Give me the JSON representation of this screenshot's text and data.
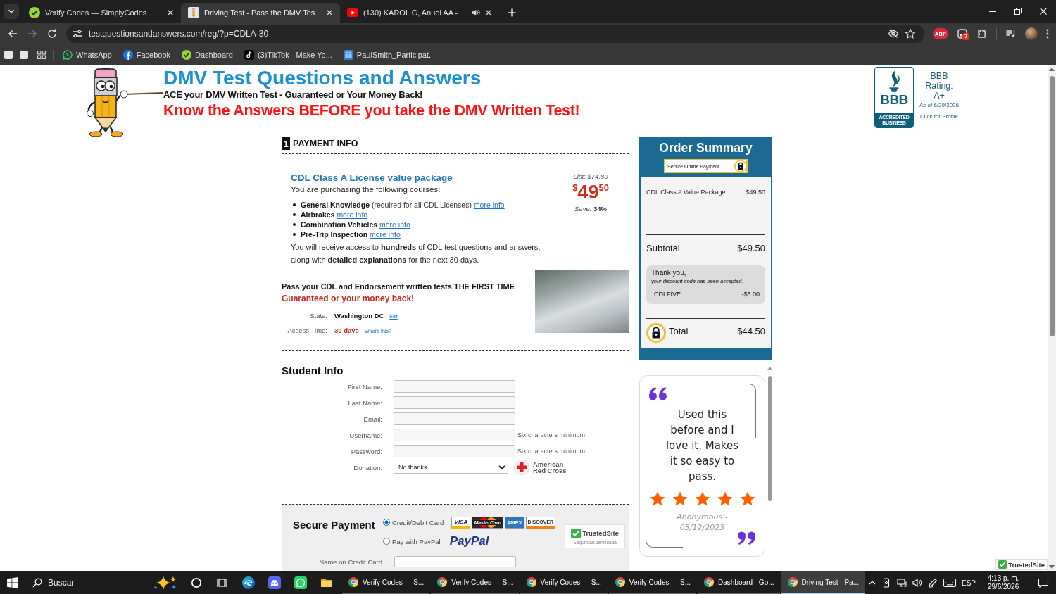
{
  "browser": {
    "tabs": [
      {
        "kind": "check",
        "title": "Verify Codes — SimplyCodes",
        "selected": false,
        "audible": false
      },
      {
        "kind": "pencil",
        "title": "Driving Test - Pass the DMV Tes",
        "selected": true,
        "audible": false
      },
      {
        "kind": "video",
        "title": "(130) KAROL G, Anuel AA -",
        "selected": false,
        "audible": true
      }
    ],
    "can_go_forward": false,
    "address": {
      "value": "testquestionsandanswers.com/reg/?p=CDLA-30"
    },
    "adblock_label": "ABP",
    "extension_badge": "7",
    "bookmarks": [
      {
        "kind": "chat",
        "label": "WhatsApp"
      },
      {
        "kind": "social",
        "label": "Facebook"
      },
      {
        "kind": "check",
        "label": "Dashboard"
      },
      {
        "kind": "note",
        "label": "(3)TikTok - Make Yo..."
      },
      {
        "kind": "tile",
        "label": "PaulSmith_Participat..."
      }
    ]
  },
  "header": {
    "title": "DMV Test Questions and Answers",
    "tagline": "ACE your DMV Written Test - Guaranteed or Your Money Back!",
    "headline": "Know the Answers BEFORE you take the DMV Written Test!"
  },
  "bbb": {
    "logo_text": "BBB",
    "logo_band": "ACCREDITED BUSINESS",
    "rating_label": "BBB Rating:",
    "rating": "A+",
    "as_of": "As of 6/29/2026",
    "link": "Click for Profile"
  },
  "payment_info": {
    "step": "1",
    "heading": "PAYMENT INFO",
    "package": {
      "title": "CDL Class A License value package",
      "intro": "You are purchasing the following courses:",
      "courses": [
        {
          "name": "General Knowledge",
          "note": "(required for all CDL Licenses)",
          "link": "more info"
        },
        {
          "name": "Airbrakes",
          "link": "more info"
        },
        {
          "name": "Combination Vehicles",
          "link": "more info"
        },
        {
          "name": "Pre-Trip Inspection",
          "link": "more info"
        }
      ],
      "summary": "You will receive access to **hundreds** of CDL test questions and answers, along with **detailed explanations** for the next 30 days."
    },
    "price": {
      "list_label": "List:",
      "list_price": "$74.80",
      "currency": "$",
      "dollars": "49",
      "cents": "50",
      "save_label": "Save:",
      "save": "34%"
    },
    "promise": "Pass your CDL and Endorsement written tests THE FIRST TIME",
    "guarantee": "Guaranteed or your money back!",
    "details": [
      {
        "label": "State:",
        "value": "Washington DC",
        "highlight": false,
        "link": "edit"
      },
      {
        "label": "Access Time:",
        "value": "30 days",
        "highlight": true,
        "link": "What's this?"
      }
    ]
  },
  "student_info": {
    "heading": "Student Info",
    "fields": [
      {
        "kind": "input",
        "label": "First Name:"
      },
      {
        "kind": "input",
        "label": "Last Name:"
      },
      {
        "kind": "input",
        "label": "Email:"
      },
      {
        "kind": "input",
        "label": "Username:",
        "hint": "Six characters minimum"
      },
      {
        "kind": "input",
        "label": "Password:",
        "hint": "Six characters minimum"
      },
      {
        "kind": "select",
        "label": "Donation:",
        "value": "No thanks"
      }
    ],
    "donation_partner": "American Red Cross"
  },
  "secure_payment": {
    "heading": "Secure Payment",
    "methods": [
      {
        "kind": "card",
        "label": "Credit/Debit Card",
        "selected": true
      },
      {
        "kind": "paypal",
        "label": "Pay with PayPal",
        "selected": false
      }
    ],
    "card_brands": [
      {
        "kind": "visa",
        "label": "VISA"
      },
      {
        "kind": "mastercard",
        "label": "MasterCard"
      },
      {
        "kind": "amex",
        "label": "AMEX"
      },
      {
        "kind": "discover",
        "label": "DISCOVER"
      }
    ],
    "paypal_logo": "PayPal",
    "trust_badge": {
      "name": "TrustedSite",
      "note": "Seguridad certificada"
    },
    "fields": [
      {
        "label": "Name on Credit Card"
      }
    ]
  },
  "order_summary": {
    "title": "Order Summary",
    "secure_label": "Secure Online Payment",
    "items": [
      {
        "name": "CDL Class A Value Package",
        "price": "$49.50"
      }
    ],
    "subtotal_label": "Subtotal",
    "subtotal": "$49.50",
    "discount": {
      "thanks": "Thank you,",
      "message": "your discount code has been accepted.",
      "code": "CDLFIVE",
      "amount": "-$5.00"
    },
    "total_label": "Total",
    "total": "$44.50"
  },
  "testimonial": {
    "text": "Used this before and I love it. Makes it so easy to pass.",
    "stars": 5,
    "author": "Anonymous -",
    "date": "03/12/2023"
  },
  "trust_seal": {
    "name": "TrustedSite"
  },
  "taskbar": {
    "search": {
      "placeholder": "Buscar"
    },
    "windows": [
      {
        "label": "Verify Codes — S...",
        "selected": false
      },
      {
        "label": "Verify Codes — S...",
        "selected": false
      },
      {
        "label": "Verify Codes — S...",
        "selected": false
      },
      {
        "label": "Verify Codes — S...",
        "selected": false
      },
      {
        "label": "Dashboard - Go...",
        "selected": false
      },
      {
        "label": "Driving Test - Pa...",
        "selected": true
      }
    ],
    "language": "ESP",
    "time": "4:13 p. m.",
    "date": "29/6/2026"
  }
}
